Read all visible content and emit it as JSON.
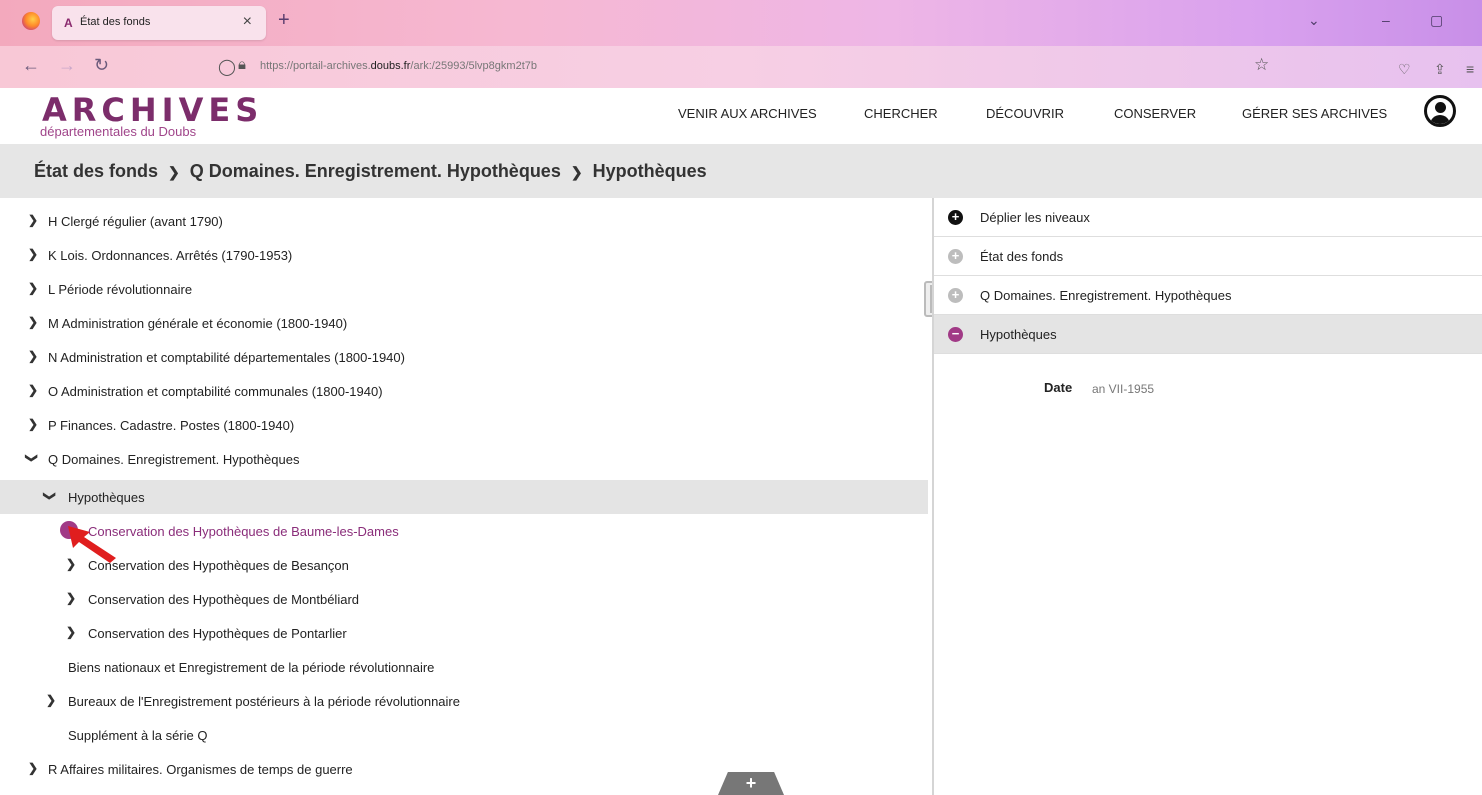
{
  "browser": {
    "tab_title": "État des fonds",
    "tab_favicon": "A",
    "url_prefix": "https://portail-archives.",
    "url_domain": "doubs.fr",
    "url_path": "/ark:/25993/5lvp8gkm2t7b"
  },
  "site": {
    "logo_main": "ARCHIVES",
    "logo_sub": "départementales du Doubs",
    "nav": [
      "VENIR AUX ARCHIVES",
      "CHERCHER",
      "DÉCOUVRIR",
      "CONSERVER",
      "GÉRER SES ARCHIVES"
    ]
  },
  "breadcrumb": [
    "État des fonds",
    "Q Domaines. Enregistrement. Hypothèques",
    "Hypothèques"
  ],
  "tree": {
    "items": [
      {
        "label": "H Clergé régulier (avant 1790)",
        "state": "collapsed"
      },
      {
        "label": "K Lois. Ordonnances. Arrêtés (1790-1953)",
        "state": "collapsed"
      },
      {
        "label": "L Période révolutionnaire",
        "state": "collapsed"
      },
      {
        "label": "M Administration générale et économie (1800-1940)",
        "state": "collapsed"
      },
      {
        "label": "N Administration et comptabilité départementales (1800-1940)",
        "state": "collapsed"
      },
      {
        "label": "O Administration et comptabilité communales (1800-1940)",
        "state": "collapsed"
      },
      {
        "label": "P Finances. Cadastre. Postes (1800-1940)",
        "state": "collapsed"
      },
      {
        "label": "Q Domaines. Enregistrement. Hypothèques",
        "state": "expanded"
      },
      {
        "label": "Hypothèques",
        "state": "expanded",
        "selected": true
      },
      {
        "label": "Conservation des Hypothèques de Baume-les-Dames",
        "state": "active"
      },
      {
        "label": "Conservation des Hypothèques de Besançon",
        "state": "collapsed"
      },
      {
        "label": "Conservation des Hypothèques de Montbéliard",
        "state": "collapsed"
      },
      {
        "label": "Conservation des Hypothèques de Pontarlier",
        "state": "collapsed"
      },
      {
        "label": "Biens nationaux et Enregistrement de la période révolutionnaire",
        "state": "leaf"
      },
      {
        "label": "Bureaux de l'Enregistrement postérieurs à la période révolutionnaire",
        "state": "collapsed"
      },
      {
        "label": "Supplément à la série Q",
        "state": "leaf"
      },
      {
        "label": "R Affaires militaires. Organismes de temps de guerre",
        "state": "collapsed"
      }
    ]
  },
  "panel": {
    "rows": [
      {
        "label": "Déplier les niveaux",
        "icon": "plus-icon"
      },
      {
        "label": "État des fonds",
        "icon": "plus-icon"
      },
      {
        "label": "Q Domaines. Enregistrement. Hypothèques",
        "icon": "plus-icon"
      },
      {
        "label": "Hypothèques",
        "icon": "minus-icon"
      }
    ],
    "date_key": "Date",
    "date_value": "an VII-1955"
  },
  "colors": {
    "accent": "#a13a86",
    "brand": "#7c2d6b"
  }
}
